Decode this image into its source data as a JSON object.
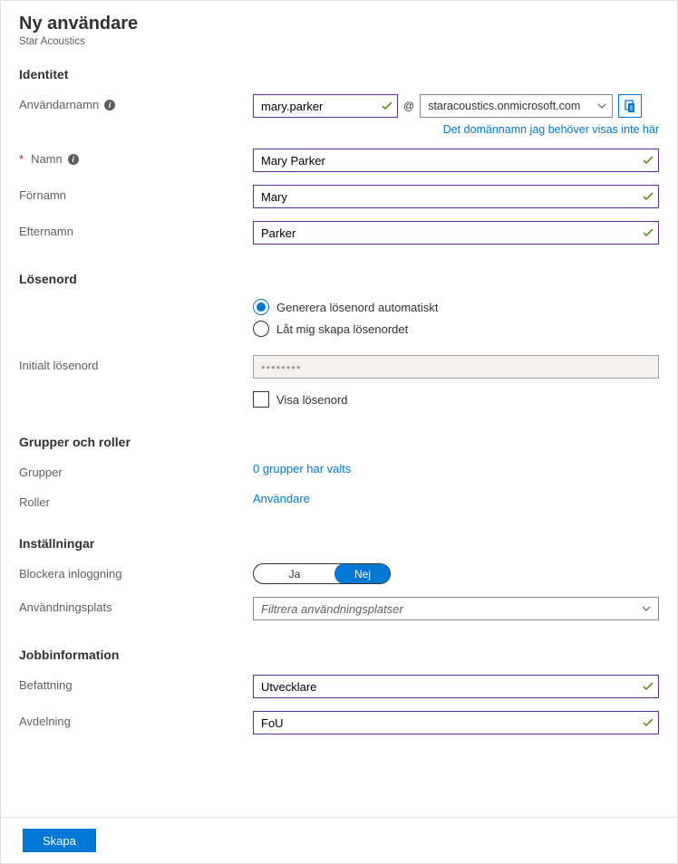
{
  "header": {
    "title": "Ny användare",
    "subtitle": "Star Acoustics"
  },
  "identity": {
    "section": "Identitet",
    "username_label": "Användarnamn",
    "username_value": "mary.parker",
    "at": "@",
    "domain_value": "staracoustics.onmicrosoft.com",
    "domain_link": "Det domännamn jag behöver visas inte här",
    "name_label": "Namn",
    "name_value": "Mary Parker",
    "firstname_label": "Förnamn",
    "firstname_value": "Mary",
    "lastname_label": "Efternamn",
    "lastname_value": "Parker"
  },
  "password": {
    "section": "Lösenord",
    "auto_label": "Generera lösenord automatiskt",
    "manual_label": "Låt mig skapa lösenordet",
    "initial_label": "Initialt lösenord",
    "value_masked": "••••••••",
    "show_label": "Visa lösenord"
  },
  "groups": {
    "section": "Grupper och roller",
    "groups_label": "Grupper",
    "groups_value": "0 grupper har valts",
    "roles_label": "Roller",
    "roles_value": "Användare"
  },
  "settings": {
    "section": "Inställningar",
    "block_label": "Blockera inloggning",
    "toggle_yes": "Ja",
    "toggle_no": "Nej",
    "location_label": "Användningsplats",
    "location_placeholder": "Filtrera användningsplatser"
  },
  "job": {
    "section": "Jobbinformation",
    "title_label": "Befattning",
    "title_value": "Utvecklare",
    "dept_label": "Avdelning",
    "dept_value": "FoU"
  },
  "footer": {
    "create": "Skapa"
  }
}
